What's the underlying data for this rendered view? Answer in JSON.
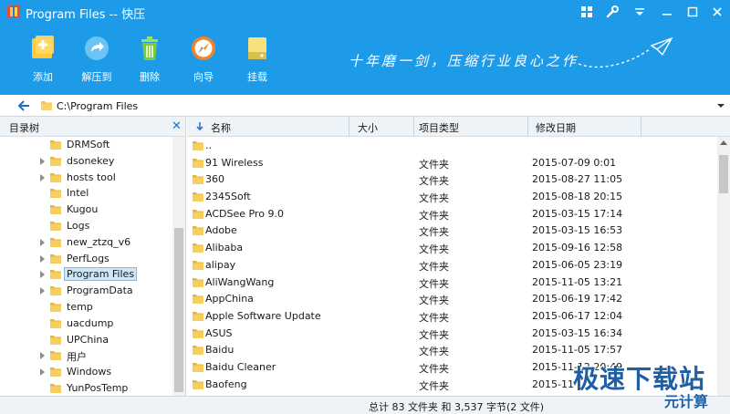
{
  "window": {
    "title": "Program Files -- 快压"
  },
  "toolbar": {
    "add": "添加",
    "extract": "解压到",
    "delete": "删除",
    "wizard": "向导",
    "mount": "挂载"
  },
  "slogan": "十年磨一剑，压缩行业良心之作",
  "address": {
    "path": "C:\\Program Files"
  },
  "tree": {
    "header": "目录树",
    "items": [
      {
        "label": "DRMSoft",
        "expandable": false
      },
      {
        "label": "dsonekey",
        "expandable": true
      },
      {
        "label": "hosts tool",
        "expandable": true
      },
      {
        "label": "Intel",
        "expandable": false
      },
      {
        "label": "Kugou",
        "expandable": false
      },
      {
        "label": "Logs",
        "expandable": false
      },
      {
        "label": "new_ztzq_v6",
        "expandable": true
      },
      {
        "label": "PerfLogs",
        "expandable": true
      },
      {
        "label": "Program Files",
        "expandable": true,
        "selected": true
      },
      {
        "label": "ProgramData",
        "expandable": true
      },
      {
        "label": "temp",
        "expandable": false
      },
      {
        "label": "uacdump",
        "expandable": false
      },
      {
        "label": "UPChina",
        "expandable": false
      },
      {
        "label": "用户",
        "expandable": true
      },
      {
        "label": "Windows",
        "expandable": true
      },
      {
        "label": "YunPosTemp",
        "expandable": false
      }
    ]
  },
  "list": {
    "columns": {
      "name": "名称",
      "size": "大小",
      "type": "项目类型",
      "date": "修改日期"
    },
    "rows": [
      {
        "name": "..",
        "type": "",
        "date": ""
      },
      {
        "name": "91 Wireless",
        "type": "文件夹",
        "date": "2015-07-09 0:01"
      },
      {
        "name": "360",
        "type": "文件夹",
        "date": "2015-08-27 11:05"
      },
      {
        "name": "2345Soft",
        "type": "文件夹",
        "date": "2015-08-18 20:15"
      },
      {
        "name": "ACDSee Pro 9.0",
        "type": "文件夹",
        "date": "2015-03-15 17:14"
      },
      {
        "name": "Adobe",
        "type": "文件夹",
        "date": "2015-03-15 16:53"
      },
      {
        "name": "Alibaba",
        "type": "文件夹",
        "date": "2015-09-16 12:58"
      },
      {
        "name": "alipay",
        "type": "文件夹",
        "date": "2015-06-05 23:19"
      },
      {
        "name": "AliWangWang",
        "type": "文件夹",
        "date": "2015-11-05 13:21"
      },
      {
        "name": "AppChina",
        "type": "文件夹",
        "date": "2015-06-19 17:42"
      },
      {
        "name": "Apple Software Update",
        "type": "文件夹",
        "date": "2015-06-17 12:04"
      },
      {
        "name": "ASUS",
        "type": "文件夹",
        "date": "2015-03-15 16:34"
      },
      {
        "name": "Baidu",
        "type": "文件夹",
        "date": "2015-11-05 17:57"
      },
      {
        "name": "Baidu Cleaner",
        "type": "文件夹",
        "date": "2015-11-12 20:49"
      },
      {
        "name": "Baofeng",
        "type": "文件夹",
        "date": "2015-11-..."
      }
    ]
  },
  "status": {
    "text": "总计 83 文件夹 和 3,537 字节(2 文件)"
  },
  "watermark": {
    "line1": "极速下载站",
    "line2": "元计算"
  },
  "colors": {
    "brand_blue": "#1e9be8",
    "folder_yellow": "#f2c44f"
  }
}
